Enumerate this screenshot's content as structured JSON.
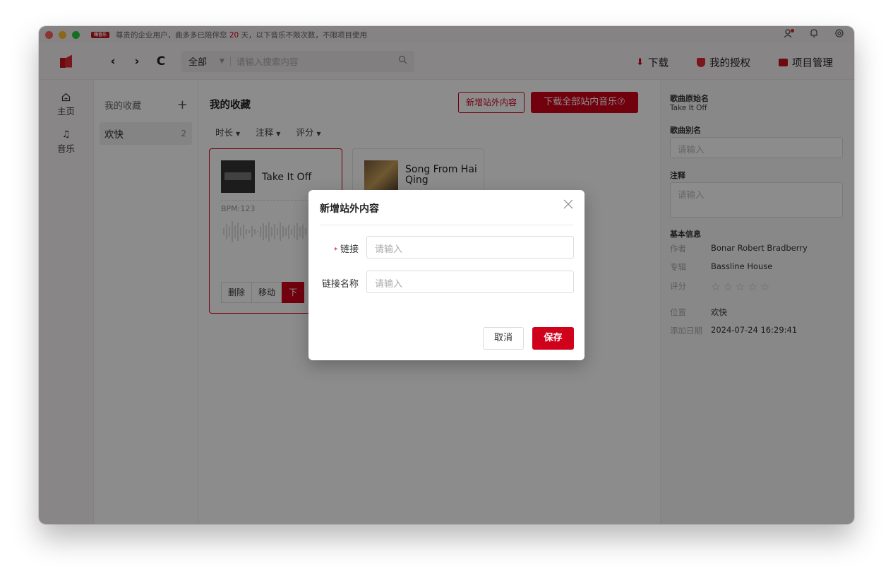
{
  "titlebar": {
    "badge": "嗨音乐",
    "notice_prefix": "尊贵的企业用户，曲多多已陪伴您 ",
    "notice_days": "20",
    "notice_suffix": " 天，以下音乐不限次数，不限项目使用"
  },
  "toolbar": {
    "back_icon": "‹",
    "forward_icon": "›",
    "refresh_icon": "C",
    "search_scope": "全部",
    "search_placeholder": "请输入搜索内容",
    "download_label": "下载",
    "license_label": "我的授权",
    "project_label": "项目管理"
  },
  "sidebar": {
    "items": [
      {
        "label": "主页",
        "icon": "home-icon"
      },
      {
        "label": "音乐",
        "icon": "music-icon"
      }
    ]
  },
  "collections": {
    "header": "我的收藏",
    "items": [
      {
        "name": "欢快",
        "count": "2"
      }
    ]
  },
  "main": {
    "title": "我的收藏",
    "add_external_label": "新增站外内容",
    "download_all_label": "下载全部站内音乐⑦",
    "filters": [
      "时长",
      "注释",
      "评分"
    ],
    "cards": [
      {
        "title": "Take It Off",
        "bpm": "BPM:123",
        "actions": [
          "删除",
          "移动",
          "下"
        ]
      },
      {
        "title": "Song From Hai Qing"
      }
    ]
  },
  "detail": {
    "original_name_label": "歌曲原始名",
    "original_name": "Take It Off",
    "alias_label": "歌曲别名",
    "alias_placeholder": "请输入",
    "note_label": "注释",
    "note_placeholder": "请输入",
    "basic_info_label": "基本信息",
    "author_key": "作者",
    "author": "Bonar Robert Bradberry",
    "album_key": "专辑",
    "album": "Bassline House",
    "rating_key": "评分",
    "rating": 0,
    "location_key": "位置",
    "location": "欢快",
    "added_key": "添加日期",
    "added": "2024-07-24 16:29:41"
  },
  "modal": {
    "title": "新增站外内容",
    "link_label": "链接",
    "link_placeholder": "请输入",
    "link_name_label": "链接名称",
    "link_name_placeholder": "请输入",
    "cancel_label": "取消",
    "save_label": "保存"
  },
  "colors": {
    "accent": "#d0021b",
    "overlay": "rgba(0,0,0,0.45)"
  }
}
